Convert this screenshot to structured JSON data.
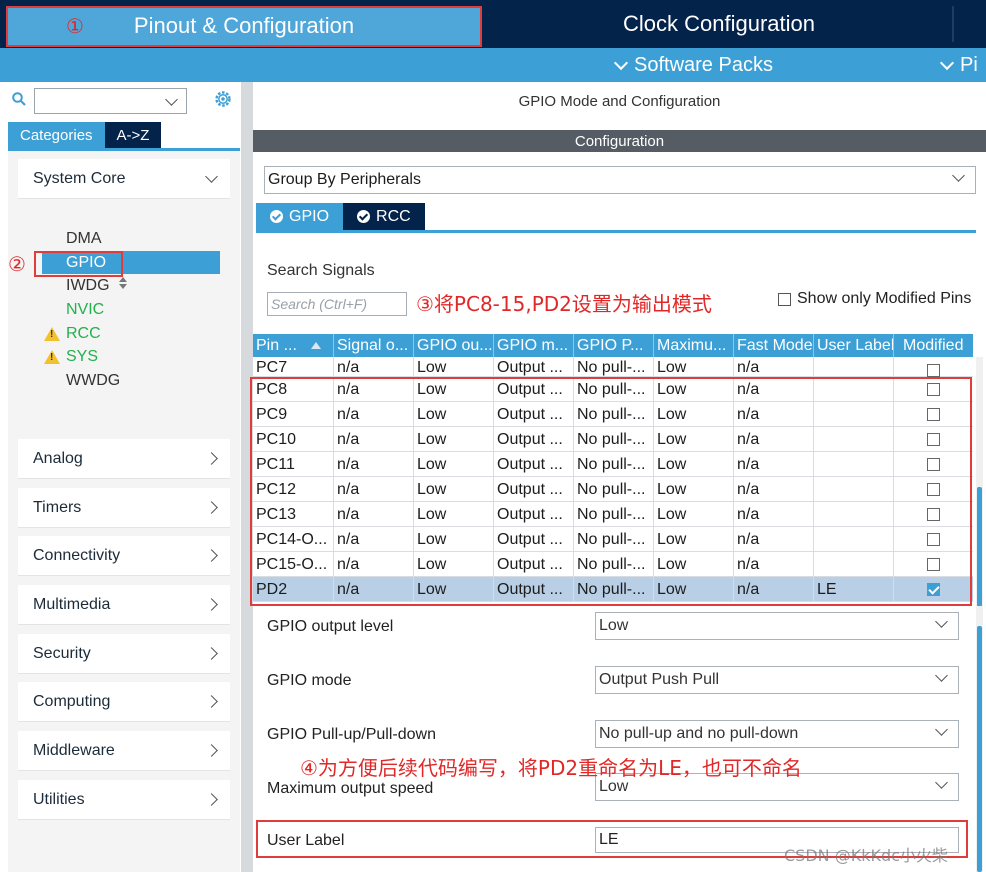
{
  "top_tabs": {
    "pinout": "Pinout & Configuration",
    "clock": "Clock Configuration"
  },
  "packs_bar": {
    "software_packs": "Software Packs",
    "pinout_cut": "Pi"
  },
  "annotations": {
    "a1": "①",
    "a2": "②",
    "a3": "③将PC8-15,PD2设置为输出模式",
    "a4": "④为方便后续代码编写，将PD2重命名为LE，也可不命名"
  },
  "left_panel": {
    "tabs": {
      "categories": "Categories",
      "az": "A->Z"
    },
    "categories": [
      {
        "label": "System Core",
        "expanded": true
      },
      {
        "label": "Analog"
      },
      {
        "label": "Timers"
      },
      {
        "label": "Connectivity"
      },
      {
        "label": "Multimedia"
      },
      {
        "label": "Security"
      },
      {
        "label": "Computing"
      },
      {
        "label": "Middleware"
      },
      {
        "label": "Utilities"
      }
    ],
    "system_core_items": [
      {
        "label": "DMA",
        "state": "normal"
      },
      {
        "label": "GPIO",
        "state": "selected"
      },
      {
        "label": "IWDG",
        "state": "normal"
      },
      {
        "label": "NVIC",
        "state": "green"
      },
      {
        "label": "RCC",
        "state": "warning"
      },
      {
        "label": "SYS",
        "state": "warning"
      },
      {
        "label": "WWDG",
        "state": "normal"
      }
    ]
  },
  "right_panel": {
    "title": "GPIO Mode and Configuration",
    "config_band": "Configuration",
    "group_select": "Group By Peripherals",
    "tabs": {
      "gpio": "GPIO",
      "rcc": "RCC"
    },
    "search_label": "Search Signals",
    "search_placeholder": "Search (Ctrl+F)",
    "show_modified": "Show only Modified Pins",
    "table": {
      "headers": [
        "Pin ...",
        "Signal o...",
        "GPIO ou...",
        "GPIO m...",
        "GPIO P...",
        "Maximu...",
        "Fast Mode",
        "User Label",
        "Modified"
      ],
      "rows": [
        [
          "PC7",
          "n/a",
          "Low",
          "Output ...",
          "No pull-...",
          "Low",
          "n/a",
          "",
          false
        ],
        [
          "PC8",
          "n/a",
          "Low",
          "Output ...",
          "No pull-...",
          "Low",
          "n/a",
          "",
          false
        ],
        [
          "PC9",
          "n/a",
          "Low",
          "Output ...",
          "No pull-...",
          "Low",
          "n/a",
          "",
          false
        ],
        [
          "PC10",
          "n/a",
          "Low",
          "Output ...",
          "No pull-...",
          "Low",
          "n/a",
          "",
          false
        ],
        [
          "PC11",
          "n/a",
          "Low",
          "Output ...",
          "No pull-...",
          "Low",
          "n/a",
          "",
          false
        ],
        [
          "PC12",
          "n/a",
          "Low",
          "Output ...",
          "No pull-...",
          "Low",
          "n/a",
          "",
          false
        ],
        [
          "PC13",
          "n/a",
          "Low",
          "Output ...",
          "No pull-...",
          "Low",
          "n/a",
          "",
          false
        ],
        [
          "PC14-O...",
          "n/a",
          "Low",
          "Output ...",
          "No pull-...",
          "Low",
          "n/a",
          "",
          false
        ],
        [
          "PC15-O...",
          "n/a",
          "Low",
          "Output ...",
          "No pull-...",
          "Low",
          "n/a",
          "",
          false
        ],
        [
          "PD2",
          "n/a",
          "Low",
          "Output ...",
          "No pull-...",
          "Low",
          "n/a",
          "LE",
          true
        ]
      ],
      "selected_row": 9
    },
    "form": {
      "output_level": {
        "label": "GPIO output level",
        "value": "Low"
      },
      "mode": {
        "label": "GPIO mode",
        "value": "Output Push Pull"
      },
      "pull": {
        "label": "GPIO Pull-up/Pull-down",
        "value": "No pull-up and no pull-down"
      },
      "speed": {
        "label": "Maximum output speed",
        "value": "Low"
      },
      "user_label": {
        "label": "User Label",
        "value": "LE"
      }
    }
  },
  "watermark": "CSDN @KkKdc小火柴",
  "colors": {
    "navy": "#03234b",
    "accent_blue": "#3ca0d6",
    "annotation_red": "#e03c3c",
    "nvic_green": "#22b14c",
    "warning_yellow": "#f2c12e"
  }
}
